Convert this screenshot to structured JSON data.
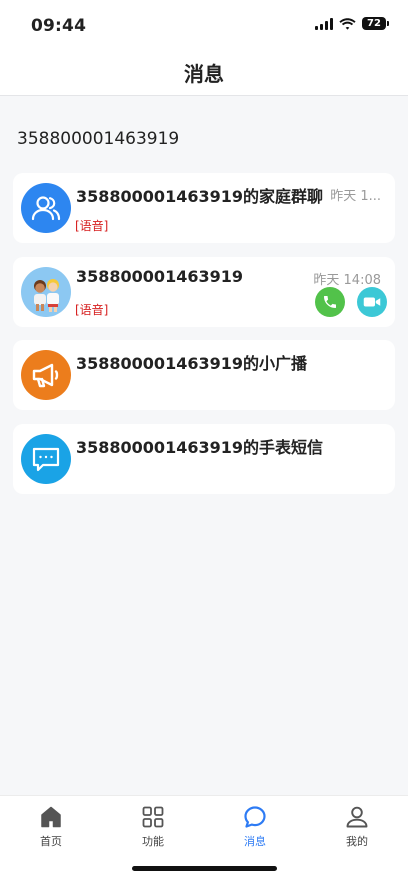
{
  "status_bar": {
    "time": "09:44",
    "battery": "72"
  },
  "header": {
    "title": "消息"
  },
  "device_id": "358800001463919",
  "conversations": [
    {
      "title": "358800001463919的家庭群聊",
      "tag": "[语音]",
      "time": "昨天 1...",
      "icon": "group-icon",
      "avatar_color": "#2d86f0"
    },
    {
      "title": "358800001463919",
      "tag": "[语音]",
      "time": "昨天 14:08",
      "icon": "kids-avatar",
      "avatar_color": "#8cc8f2"
    },
    {
      "title": "358800001463919的小广播",
      "icon": "megaphone-icon",
      "avatar_color": "#ec7d1c"
    },
    {
      "title": "358800001463919的手表短信",
      "icon": "sms-icon",
      "avatar_color": "#1aa3e6"
    }
  ],
  "call_buttons": {
    "voice_color": "#52c24a",
    "video_color": "#3cc8d6"
  },
  "tabbar": {
    "items": [
      {
        "label": "首页",
        "icon": "home-icon"
      },
      {
        "label": "功能",
        "icon": "grid-icon"
      },
      {
        "label": "消息",
        "icon": "message-icon",
        "active": true
      },
      {
        "label": "我的",
        "icon": "profile-icon"
      }
    ],
    "active_color": "#2d7bf4"
  }
}
